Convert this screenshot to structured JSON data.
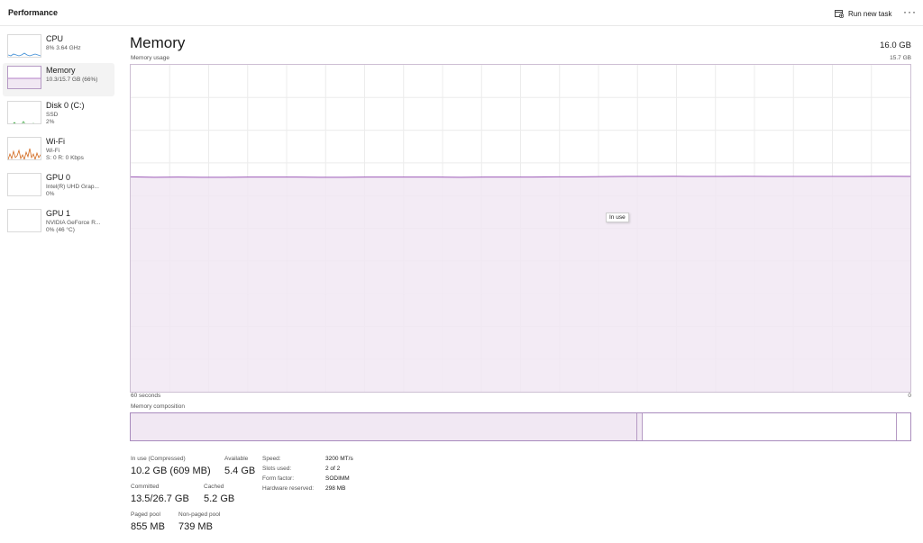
{
  "header": {
    "title": "Performance",
    "run_new_task": "Run new task",
    "more": "···"
  },
  "sidebar": {
    "items": [
      {
        "title": "CPU",
        "lines": [
          "8% 3.64 GHz"
        ],
        "thumb_color": "#3c8dd6",
        "selected": false
      },
      {
        "title": "Memory",
        "lines": [
          "10.3/15.7 GB (66%)"
        ],
        "thumb_color": "#9b59b6",
        "selected": true
      },
      {
        "title": "Disk 0 (C:)",
        "lines": [
          "SSD",
          "2%"
        ],
        "thumb_color": "#4caf50",
        "selected": false
      },
      {
        "title": "Wi-Fi",
        "lines": [
          "Wi-Fi",
          "S: 0 R: 0 Kbps"
        ],
        "thumb_color": "#d2691e",
        "selected": false
      },
      {
        "title": "GPU 0",
        "lines": [
          "Intel(R) UHD Grap...",
          "0%"
        ],
        "thumb_color": "#3c8dd6",
        "selected": false
      },
      {
        "title": "GPU 1",
        "lines": [
          "NVIDIA GeForce R...",
          "0% (46 °C)"
        ],
        "thumb_color": "#3c8dd6",
        "selected": false
      }
    ]
  },
  "main": {
    "title": "Memory",
    "total": "16.0 GB",
    "graph_label": "Memory usage",
    "graph_max": "15.7 GB",
    "tooltip": "In use",
    "axis_left": "60 seconds",
    "axis_right": "0",
    "composition_label": "Memory composition"
  },
  "chart_data": {
    "type": "area",
    "x_label": "60 seconds",
    "ylim": [
      0,
      15.7
    ],
    "grid": true,
    "series": [
      {
        "name": "In use",
        "values": [
          10.32,
          10.3,
          10.31,
          10.3,
          10.3,
          10.31,
          10.31,
          10.31,
          10.3,
          10.3,
          10.31,
          10.31,
          10.31,
          10.31,
          10.3,
          10.31,
          10.31,
          10.31,
          10.32,
          10.32,
          10.33,
          10.34,
          10.34,
          10.35,
          10.34,
          10.34,
          10.35,
          10.34,
          10.34,
          10.34,
          10.34,
          10.34,
          10.35,
          10.34
        ]
      }
    ],
    "color": "#9b59b6"
  },
  "stats": {
    "in_use_label": "In use (Compressed)",
    "in_use_value": "10.2 GB (609 MB)",
    "available_label": "Available",
    "available_value": "5.4 GB",
    "committed_label": "Committed",
    "committed_value": "13.5/26.7 GB",
    "cached_label": "Cached",
    "cached_value": "5.2 GB",
    "paged_label": "Paged pool",
    "paged_value": "855 MB",
    "nonpaged_label": "Non-paged pool",
    "nonpaged_value": "739 MB"
  },
  "details": [
    {
      "key": "Speed:",
      "value": "3200 MT/s"
    },
    {
      "key": "Slots used:",
      "value": "2 of 2"
    },
    {
      "key": "Form factor:",
      "value": "SODIMM"
    },
    {
      "key": "Hardware reserved:",
      "value": "298 MB"
    }
  ]
}
